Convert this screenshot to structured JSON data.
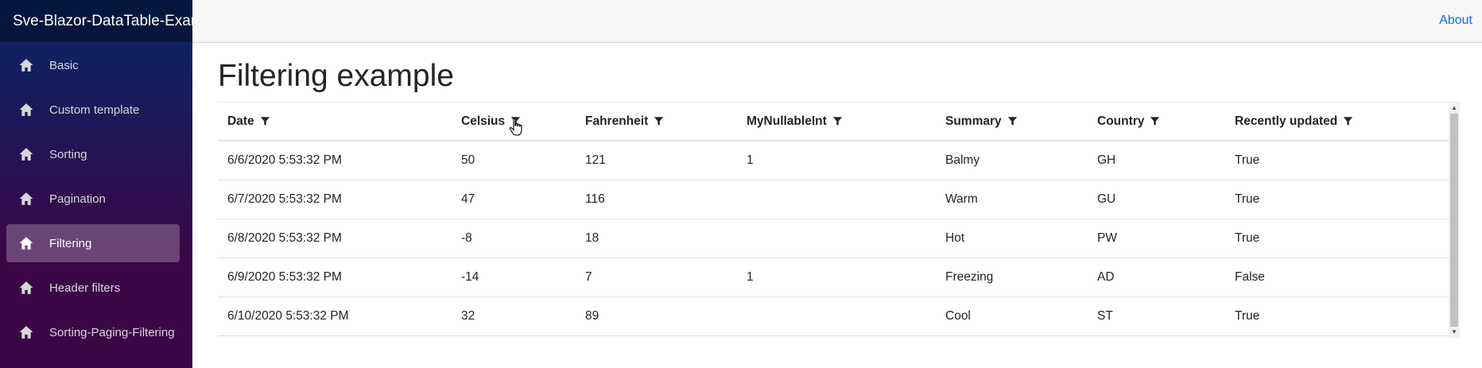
{
  "app": {
    "brand": "Sve-Blazor-DataTable-Examples"
  },
  "sidebar": {
    "items": [
      {
        "label": "Basic",
        "active": false
      },
      {
        "label": "Custom template",
        "active": false
      },
      {
        "label": "Sorting",
        "active": false
      },
      {
        "label": "Pagination",
        "active": false
      },
      {
        "label": "Filtering",
        "active": true
      },
      {
        "label": "Header filters",
        "active": false
      },
      {
        "label": "Sorting-Paging-Filtering",
        "active": false
      }
    ]
  },
  "topbar": {
    "about": "About"
  },
  "page": {
    "title": "Filtering example"
  },
  "table": {
    "columns": [
      "Date",
      "Celsius",
      "Fahrenheit",
      "MyNullableInt",
      "Summary",
      "Country",
      "Recently updated"
    ],
    "rows": [
      [
        "6/6/2020 5:53:32 PM",
        "50",
        "121",
        "1",
        "Balmy",
        "GH",
        "True"
      ],
      [
        "6/7/2020 5:53:32 PM",
        "47",
        "116",
        "",
        "Warm",
        "GU",
        "True"
      ],
      [
        "6/8/2020 5:53:32 PM",
        "-8",
        "18",
        "",
        "Hot",
        "PW",
        "True"
      ],
      [
        "6/9/2020 5:53:32 PM",
        "-14",
        "7",
        "1",
        "Freezing",
        "AD",
        "False"
      ],
      [
        "6/10/2020 5:53:32 PM",
        "32",
        "89",
        "",
        "Cool",
        "ST",
        "True"
      ]
    ]
  },
  "icons": {
    "nav": "home-icon",
    "column_filter": "filter-icon"
  },
  "colors": {
    "link": "#1b6ec2",
    "sidebar_top": "#052767",
    "sidebar_bottom": "#3a0647"
  }
}
